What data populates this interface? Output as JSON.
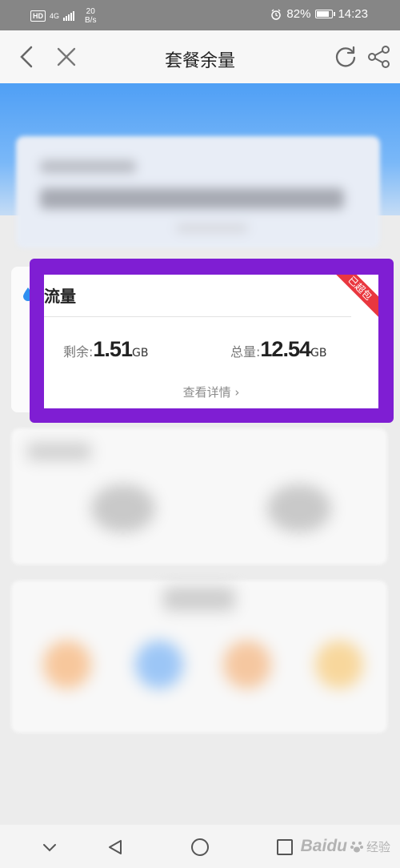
{
  "status_bar": {
    "hd": "HD",
    "network": "4G",
    "speed_value": "20",
    "speed_unit": "B/s",
    "battery": "82%",
    "time": "14:23"
  },
  "nav": {
    "title": "套餐余量"
  },
  "flow_card": {
    "title": "流量",
    "ribbon": "已超包",
    "remaining_label": "剩余:",
    "remaining_value": "1.51",
    "remaining_unit": "GB",
    "total_label": "总量:",
    "total_value": "12.54",
    "total_unit": "GB",
    "detail_link": "查看详情 ›"
  },
  "watermark": {
    "brand": "Baidu",
    "sub": "经验"
  },
  "colors": {
    "highlight": "#7f1ed3",
    "header_blue": "#4f9ff5",
    "ribbon": "#e9373f"
  }
}
